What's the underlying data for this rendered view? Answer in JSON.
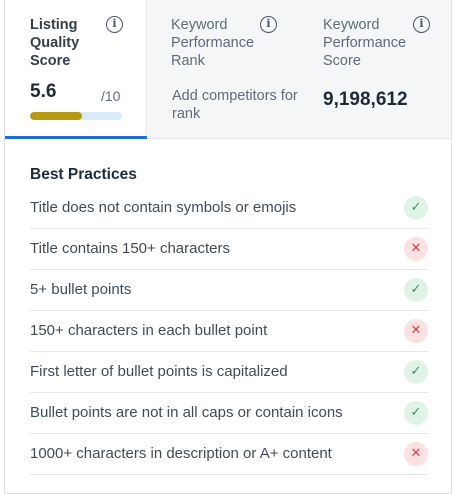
{
  "metrics": {
    "listing_quality": {
      "title": "Listing Quality Score",
      "score": "5.6",
      "denominator": "/10",
      "progress_fraction": 0.56
    },
    "keyword_rank": {
      "title": "Keyword Performance Rank",
      "link_text": "Add competitors for rank"
    },
    "keyword_score": {
      "title": "Keyword Performance Score",
      "value": "9,198,612"
    },
    "info_icon": "info-icon",
    "colors": {
      "active_tab_underline": "#1f6fd1",
      "progress_fill": "#b59a13",
      "progress_track": "#d9ecfb",
      "pass": "#2e9a5a",
      "fail": "#d64545"
    }
  },
  "best_practices": {
    "title": "Best Practices",
    "items": [
      {
        "label": "Title does not contain symbols or emojis",
        "status": "pass"
      },
      {
        "label": "Title contains 150+ characters",
        "status": "fail"
      },
      {
        "label": "5+ bullet points",
        "status": "pass"
      },
      {
        "label": "150+ characters in each bullet point",
        "status": "fail"
      },
      {
        "label": "First letter of bullet points is capitalized",
        "status": "pass"
      },
      {
        "label": "Bullet points are not in all caps or contain icons",
        "status": "pass"
      },
      {
        "label": "1000+ characters in description or A+ content",
        "status": "fail"
      }
    ]
  }
}
